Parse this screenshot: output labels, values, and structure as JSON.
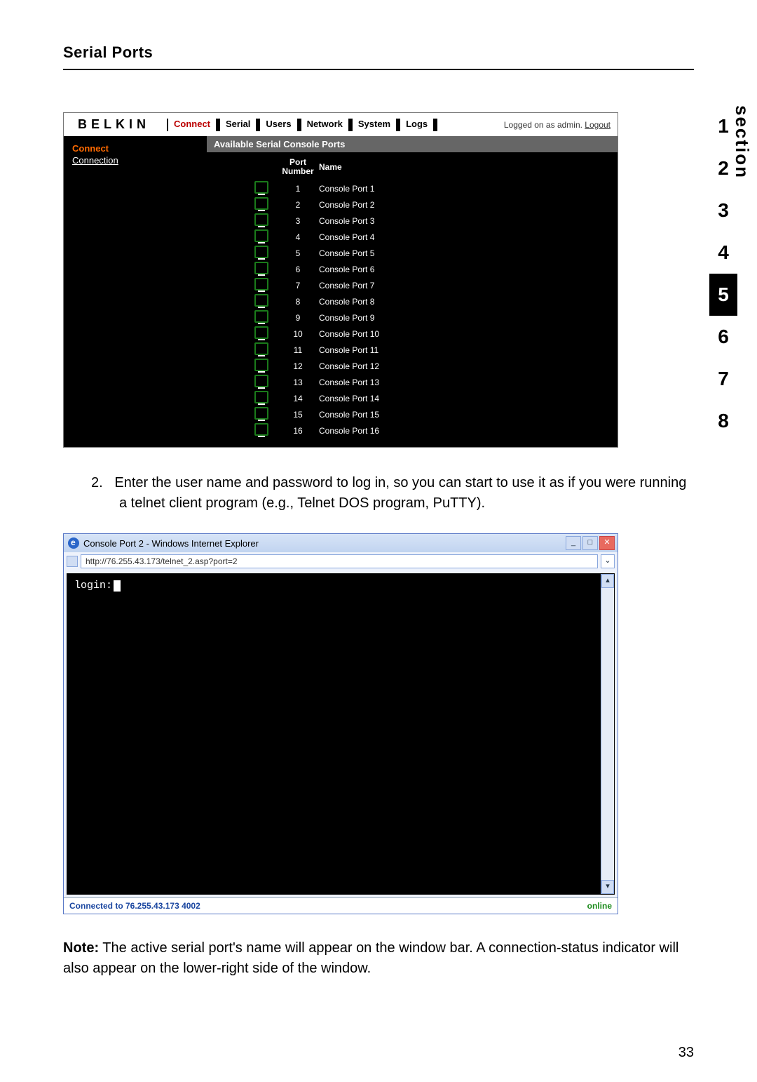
{
  "page_title": "Serial Ports",
  "section_nav": {
    "label": "section",
    "items": [
      "1",
      "2",
      "3",
      "4",
      "5",
      "6",
      "7",
      "8"
    ],
    "active_index": 4
  },
  "belkin": {
    "brand": "BELKIN",
    "nav": [
      "Connect",
      "Serial",
      "Users",
      "Network",
      "System",
      "Logs"
    ],
    "active_nav_index": 0,
    "login_prefix": "Logged on as admin. ",
    "logout": "Logout",
    "sidebar_title": "Connect",
    "sidebar_link": "Connection",
    "table_title": "Available Serial Console Ports",
    "col_port_number": "Port Number",
    "col_name": "Name",
    "ports": [
      {
        "num": 1,
        "name": "Console Port 1"
      },
      {
        "num": 2,
        "name": "Console Port 2"
      },
      {
        "num": 3,
        "name": "Console Port 3"
      },
      {
        "num": 4,
        "name": "Console Port 4"
      },
      {
        "num": 5,
        "name": "Console Port 5"
      },
      {
        "num": 6,
        "name": "Console Port 6"
      },
      {
        "num": 7,
        "name": "Console Port 7"
      },
      {
        "num": 8,
        "name": "Console Port 8"
      },
      {
        "num": 9,
        "name": "Console Port 9"
      },
      {
        "num": 10,
        "name": "Console Port 10"
      },
      {
        "num": 11,
        "name": "Console Port 11"
      },
      {
        "num": 12,
        "name": "Console Port 12"
      },
      {
        "num": 13,
        "name": "Console Port 13"
      },
      {
        "num": 14,
        "name": "Console Port 14"
      },
      {
        "num": 15,
        "name": "Console Port 15"
      },
      {
        "num": 16,
        "name": "Console Port 16"
      }
    ]
  },
  "step2": {
    "number": "2.",
    "text": "Enter the user name and password to log in, so you can start to use it as if you were running a telnet client program (e.g., Telnet DOS program, PuTTY)."
  },
  "ie": {
    "title": "Console Port 2 - Windows Internet Explorer",
    "url": "http://76.255.43.173/telnet_2.asp?port=2",
    "terminal_prompt": "login:",
    "status_left": "Connected to 76.255.43.173 4002",
    "status_right": "online",
    "btn_min": "_",
    "btn_max": "□",
    "btn_close": "✕",
    "drop": "⌄",
    "scroll_up": "▴",
    "scroll_down": "▾"
  },
  "note_label": "Note:",
  "note_text": " The active serial port's name will appear on the window bar. A connection-status indicator will also appear on the lower-right side of the window.",
  "page_number": "33"
}
